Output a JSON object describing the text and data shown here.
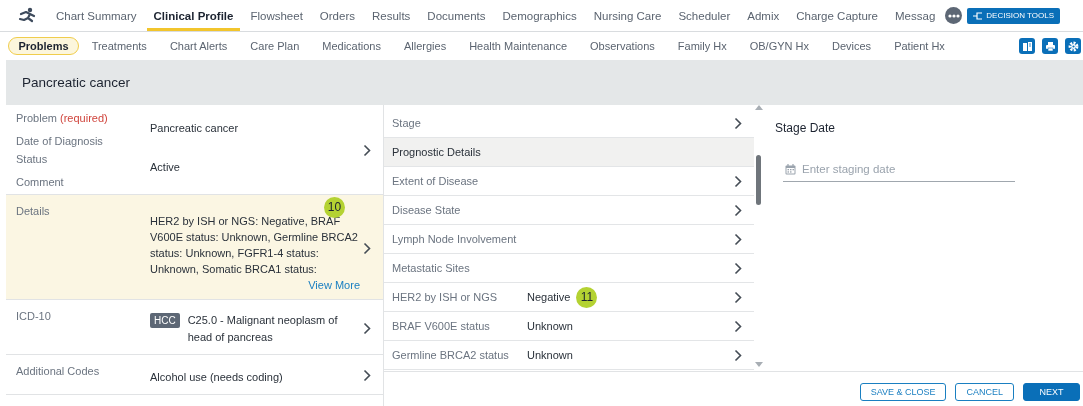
{
  "nav": {
    "tabs": [
      {
        "label": "Chart Summary",
        "selected": false
      },
      {
        "label": "Clinical Profile",
        "selected": true
      },
      {
        "label": "Flowsheet",
        "selected": false
      },
      {
        "label": "Orders",
        "selected": false
      },
      {
        "label": "Results",
        "selected": false
      },
      {
        "label": "Documents",
        "selected": false
      },
      {
        "label": "Demographics",
        "selected": false
      },
      {
        "label": "Nursing Care",
        "selected": false
      },
      {
        "label": "Scheduler",
        "selected": false
      },
      {
        "label": "Admix",
        "selected": false
      },
      {
        "label": "Charge Capture",
        "selected": false
      },
      {
        "label": "Messag",
        "selected": false
      }
    ],
    "decision_tools": "DECISION TOOLS"
  },
  "subnav": {
    "tabs": [
      {
        "label": "Problems",
        "selected": true
      },
      {
        "label": "Treatments",
        "selected": false
      },
      {
        "label": "Chart Alerts",
        "selected": false
      },
      {
        "label": "Care Plan",
        "selected": false
      },
      {
        "label": "Medications",
        "selected": false
      },
      {
        "label": "Allergies",
        "selected": false
      },
      {
        "label": "Health Maintenance",
        "selected": false
      },
      {
        "label": "Observations",
        "selected": false
      },
      {
        "label": "Family Hx",
        "selected": false
      },
      {
        "label": "OB/GYN Hx",
        "selected": false
      },
      {
        "label": "Devices",
        "selected": false
      },
      {
        "label": "Patient Hx",
        "selected": false
      }
    ]
  },
  "header": {
    "title": "Pancreatic cancer"
  },
  "problem_fields": [
    {
      "kind": "summary",
      "labels": [
        {
          "text": "Problem",
          "note": "(required)"
        },
        {
          "text": "Date of Diagnosis"
        },
        {
          "text": "Status"
        },
        {
          "text": "Comment"
        }
      ],
      "values": [
        "Pancreatic cancer",
        "Active"
      ]
    },
    {
      "kind": "details",
      "label": "Details",
      "highlighted": true,
      "badge": "10",
      "value": "HER2 by ISH or NGS: Negative, BRAF V600E status: Unknown, Germline BRCA2 status: Unknown, FGFR1-4 status: Unknown, Somatic BRCA1 status:",
      "link": "View More"
    },
    {
      "kind": "code",
      "label": "ICD-10",
      "highlighted": false,
      "tag": "HCC",
      "value": "C25.0 - Malignant neoplasm of head of pancreas"
    },
    {
      "kind": "plain",
      "label": "Additional Codes",
      "highlighted": false,
      "value": "Alcohol use (needs coding)"
    }
  ],
  "prognostic_list": [
    {
      "kind": "item",
      "label": "Stage"
    },
    {
      "kind": "section",
      "label": "Prognostic Details"
    },
    {
      "kind": "item",
      "label": "Extent of Disease"
    },
    {
      "kind": "item",
      "label": "Disease State"
    },
    {
      "kind": "item",
      "label": "Lymph Node Involvement"
    },
    {
      "kind": "item",
      "label": "Metastatic Sites"
    },
    {
      "kind": "item",
      "label": "HER2 by ISH or NGS",
      "value": "Negative",
      "badge": "11"
    },
    {
      "kind": "item",
      "label": "BRAF V600E status",
      "value": "Unknown"
    },
    {
      "kind": "item",
      "label": "Germline BRCA2 status",
      "value": "Unknown"
    }
  ],
  "stage_date": {
    "title": "Stage Date",
    "placeholder": "Enter staging date"
  },
  "buttons": [
    {
      "label": "SAVE & CLOSE",
      "kind": "outline"
    },
    {
      "label": "CANCEL",
      "kind": "outline"
    },
    {
      "label": "NEXT",
      "kind": "primary"
    }
  ]
}
